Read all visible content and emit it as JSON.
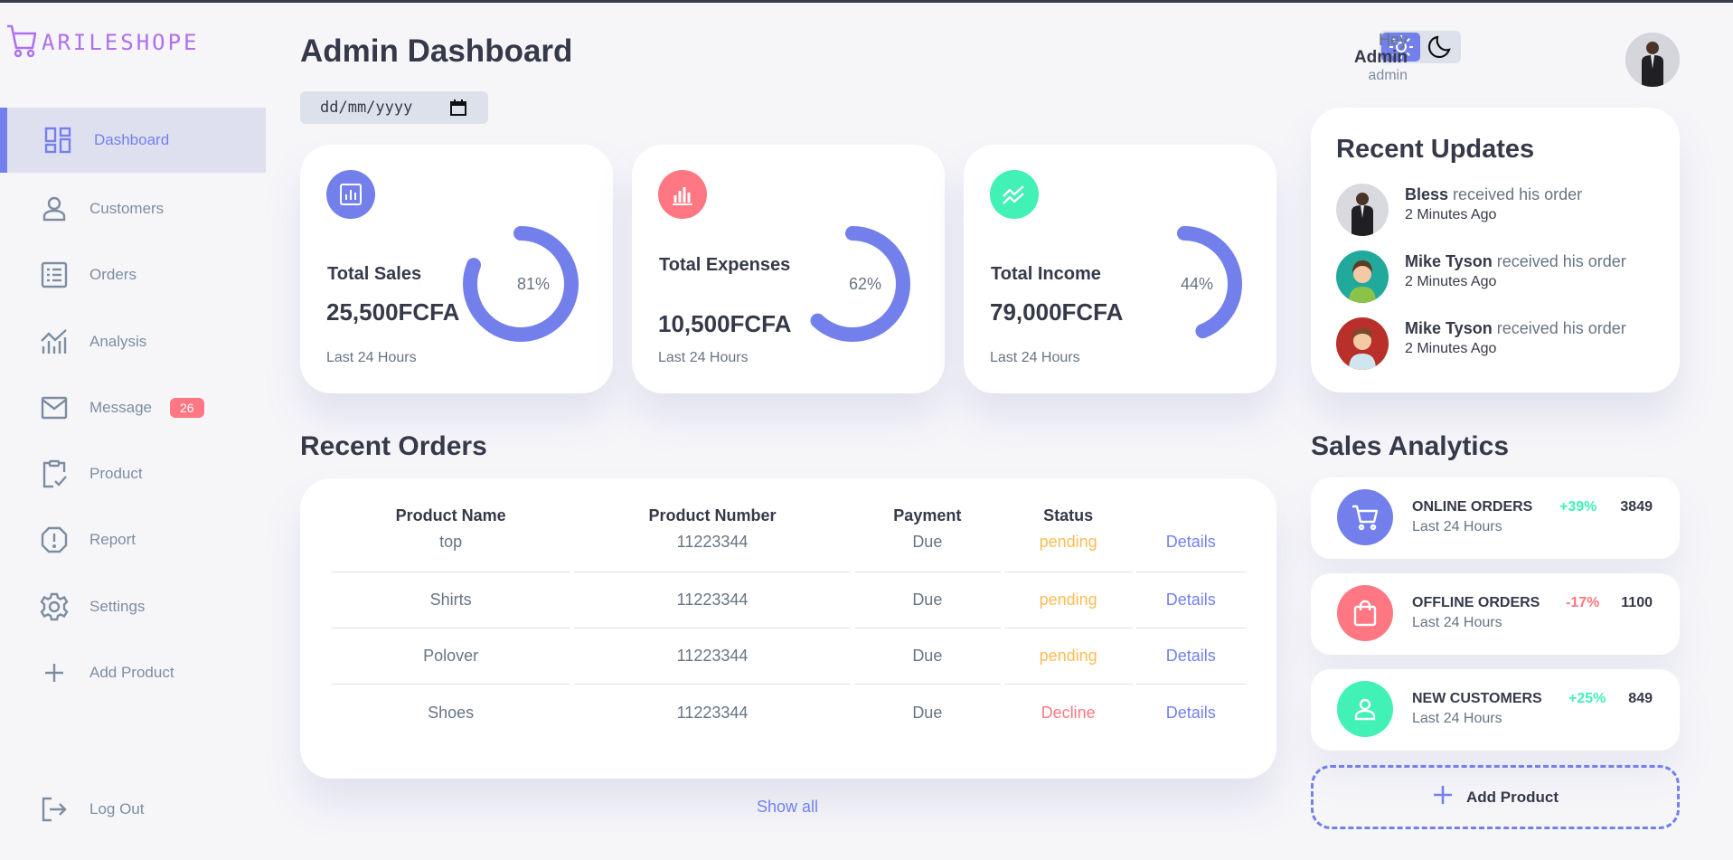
{
  "brand": {
    "name": "ARILESHOPE"
  },
  "sidebar": {
    "items": [
      {
        "label": "Dashboard",
        "icon": "grid-view-icon"
      },
      {
        "label": "Customers",
        "icon": "person-icon"
      },
      {
        "label": "Orders",
        "icon": "receipt-list-icon"
      },
      {
        "label": "Analysis",
        "icon": "insights-icon"
      },
      {
        "label": "Message",
        "icon": "mail-icon",
        "badge": "26"
      },
      {
        "label": "Product",
        "icon": "inventory-icon"
      },
      {
        "label": "Report",
        "icon": "report-icon"
      },
      {
        "label": "Settings",
        "icon": "gear-icon"
      },
      {
        "label": "Add Product",
        "icon": "plus-icon"
      }
    ],
    "logout": {
      "label": "Log Out"
    }
  },
  "header": {
    "title": "Admin Dashboard",
    "date_placeholder": "dd/mm/yyyy"
  },
  "cards": [
    {
      "title": "Total Sales",
      "value": "25,500FCFA",
      "percent_label": "81%",
      "percent": 81,
      "sub": "Last 24 Hours",
      "color": "#7380ec"
    },
    {
      "title": "Total Expenses",
      "value": "10,500FCFA",
      "percent_label": "62%",
      "percent": 62,
      "sub": "Last 24 Hours",
      "color": "#ff7782"
    },
    {
      "title": "Total Income",
      "value": "79,000FCFA",
      "percent_label": "44%",
      "percent": 44,
      "sub": "Last 24 Hours",
      "color": "#41f1b6"
    }
  ],
  "recent_orders": {
    "title": "Recent Orders",
    "columns": [
      "Product Name",
      "Product Number",
      "Payment",
      "Status"
    ],
    "rows": [
      {
        "name": "top",
        "number": "11223344",
        "payment": "Due",
        "status": "pending",
        "action": "Details"
      },
      {
        "name": "Shirts",
        "number": "11223344",
        "payment": "Due",
        "status": "pending",
        "action": "Details"
      },
      {
        "name": "Polover",
        "number": "11223344",
        "payment": "Due",
        "status": "pending",
        "action": "Details"
      },
      {
        "name": "Shoes",
        "number": "11223344",
        "payment": "Due",
        "status": "Decline",
        "action": "Details"
      }
    ],
    "show_all": "Show all"
  },
  "profile": {
    "greeting": "Hey",
    "name": "Admin",
    "role": "admin"
  },
  "recent_updates": {
    "title": "Recent Updates",
    "items": [
      {
        "name": "Bless",
        "text": " received his order",
        "time": "2 Minutes Ago"
      },
      {
        "name": "Mike Tyson",
        "text": " received his order",
        "time": "2 Minutes Ago"
      },
      {
        "name": "Mike Tyson",
        "text": " received his order",
        "time": "2 Minutes Ago"
      }
    ]
  },
  "sales_analytics": {
    "title": "Sales Analytics",
    "items": [
      {
        "label": "ONLINE ORDERS",
        "sub": "Last 24 Hours",
        "change": "+39%",
        "count": "3849",
        "color": "#7380ec"
      },
      {
        "label": "OFFLINE ORDERS",
        "sub": "Last 24 Hours",
        "change": "-17%",
        "count": "1100",
        "color": "#ff7782"
      },
      {
        "label": "NEW CUSTOMERS",
        "sub": "Last 24 Hours",
        "change": "+25%",
        "count": "849",
        "color": "#41f1b6"
      }
    ],
    "add_product": "Add Product"
  },
  "colors": {
    "primary": "#7380ec",
    "danger": "#ff7782",
    "success": "#41f1b6",
    "warning": "#ffbb55"
  }
}
